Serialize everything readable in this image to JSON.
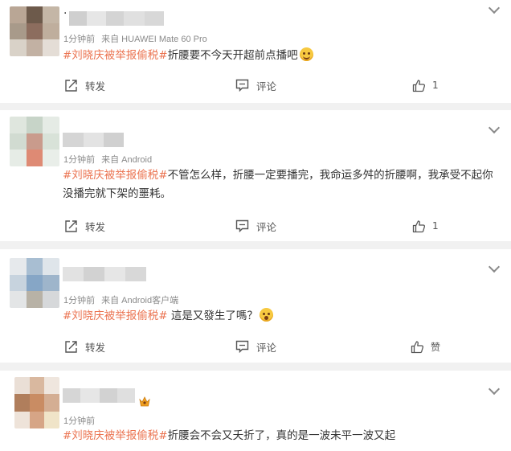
{
  "comments": [
    {
      "name": "·",
      "time": "1分钟前",
      "source": "来自 HUAWEI Mate 60 Pro",
      "tag": "#刘晓庆被举报偷税#",
      "text": "折腰要不今天开超前点播吧",
      "emoji": "smile-emoji",
      "actions": {
        "share": "转发",
        "comment": "评论",
        "like": "1"
      }
    },
    {
      "name": "",
      "time": "1分钟前",
      "source": "来自 Android",
      "tag": "#刘晓庆被举报偷税#",
      "text": "不管怎么样，折腰一定要播完，我命运多舛的折腰啊，我承受不起你没播完就下架的噩耗。",
      "emoji": "",
      "actions": {
        "share": "转发",
        "comment": "评论",
        "like": "1"
      }
    },
    {
      "name": "",
      "time": "1分钟前",
      "source": "来自 Android客户端",
      "tag": "#刘晓庆被举报偷税#",
      "text": " 這是又發生了嗎？",
      "emoji": "surprise-emoji",
      "actions": {
        "share": "转发",
        "comment": "评论",
        "like": "赞"
      }
    },
    {
      "name": "",
      "time": "1分钟前",
      "source": "",
      "tag": "#刘晓庆被举报偷税#",
      "text": "折腰会不会又夭折了，真的是一波未平一波又起",
      "emoji": "",
      "actions": null
    }
  ],
  "colors": {
    "tag": "#eb7350",
    "meta": "#8a8a8a",
    "background": "#f1f1f1"
  },
  "icons": {
    "share": "share-icon",
    "comment": "comment-icon",
    "like": "thumbs-up-icon",
    "more": "chevron-down-icon"
  }
}
